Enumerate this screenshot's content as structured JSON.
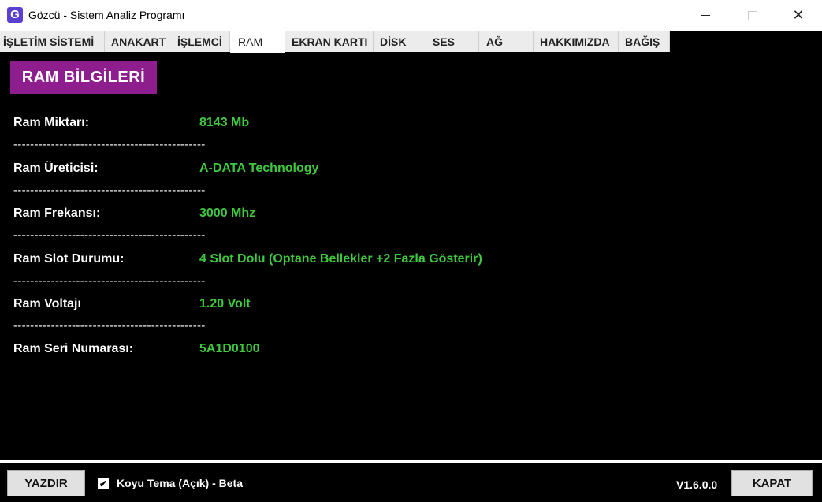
{
  "window": {
    "icon_letter": "G",
    "title": "Gözcü - Sistem Analiz Programı",
    "min_glyph": "",
    "close_glyph": "✕"
  },
  "tabs": [
    {
      "label": "İŞLETİM SİSTEMİ",
      "active": false
    },
    {
      "label": "ANAKART",
      "active": false
    },
    {
      "label": "İŞLEMCİ",
      "active": false
    },
    {
      "label": "RAM",
      "active": true
    },
    {
      "label": "EKRAN KARTI",
      "active": false
    },
    {
      "label": "DİSK",
      "active": false
    },
    {
      "label": "SES",
      "active": false
    },
    {
      "label": "AĞ",
      "active": false
    },
    {
      "label": "HAKKIMIZDA",
      "active": false
    },
    {
      "label": "BAĞIŞ",
      "active": false
    }
  ],
  "section": {
    "title": "RAM BİLGİLERİ"
  },
  "separator": "----------------------------------------------",
  "rows": [
    {
      "label": "Ram Miktarı:",
      "value": "8143 Mb"
    },
    {
      "label": "Ram Üreticisi:",
      "value": "A-DATA Technology"
    },
    {
      "label": "Ram Frekansı:",
      "value": "3000 Mhz"
    },
    {
      "label": "Ram Slot Durumu:",
      "value": "4 Slot Dolu  (Optane Bellekler +2 Fazla Gösterir)"
    },
    {
      "label": "Ram Voltajı",
      "value": "1.20 Volt"
    },
    {
      "label": "Ram Seri Numarası:",
      "value": "5A1D0100"
    }
  ],
  "footer": {
    "print_label": "YAZDIR",
    "dark_theme_label": "Koyu Tema (Açık) - Beta",
    "dark_theme_checked": true,
    "check_glyph": "✔",
    "version": "V1.6.0.0",
    "close_label": "KAPAT"
  },
  "colors": {
    "header_bg": "#8e1d8e",
    "value_text": "#3fc93f",
    "content_bg": "#000000"
  }
}
